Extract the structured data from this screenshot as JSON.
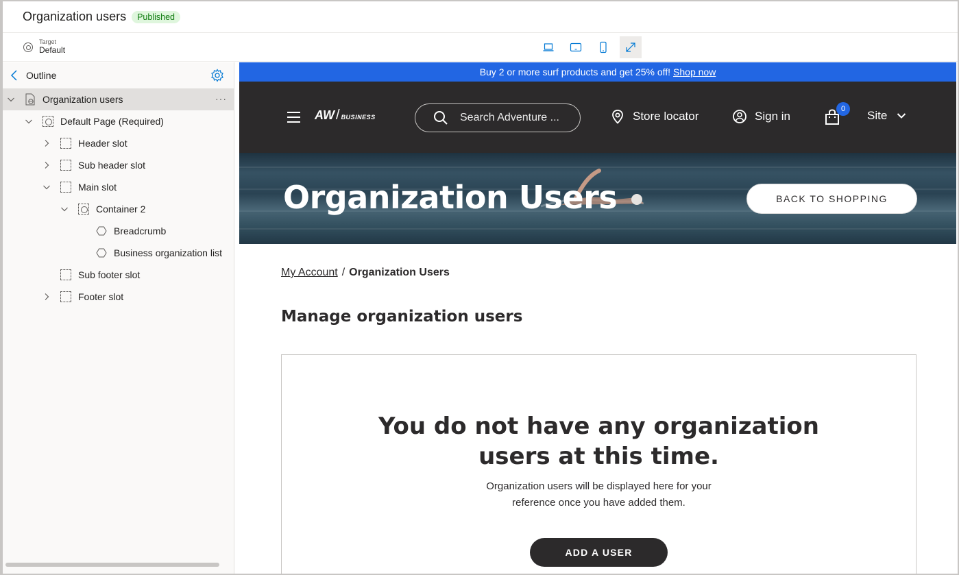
{
  "titlebar": {
    "title": "Organization users",
    "status": "Published"
  },
  "target": {
    "label": "Target",
    "value": "Default"
  },
  "devices": [
    "laptop-icon",
    "tablet-landscape-icon",
    "mobile-icon",
    "expand-icon"
  ],
  "outline": {
    "title": "Outline",
    "items": [
      {
        "label": "Organization users",
        "type": "page",
        "more": "···"
      },
      {
        "label": "Default Page (Required)",
        "type": "container"
      },
      {
        "label": "Header slot",
        "type": "slot"
      },
      {
        "label": "Sub header slot",
        "type": "slot"
      },
      {
        "label": "Main slot",
        "type": "slot"
      },
      {
        "label": "Container 2",
        "type": "container"
      },
      {
        "label": "Breadcrumb",
        "type": "module"
      },
      {
        "label": "Business organization list",
        "type": "module"
      },
      {
        "label": "Sub footer slot",
        "type": "slot"
      },
      {
        "label": "Footer slot",
        "type": "slot"
      }
    ]
  },
  "promo": {
    "text": "Buy 2 or more surf products and get 25% off!",
    "link": "Shop now"
  },
  "site_header": {
    "logo_main": "AW",
    "logo_slash": "/",
    "logo_sub": "BUSINESS",
    "search_placeholder": "Search Adventure ...",
    "store_locator": "Store locator",
    "sign_in": "Sign in",
    "cart_count": "0",
    "site": "Site"
  },
  "hero": {
    "title": "Organization Users",
    "button": "BACK TO SHOPPING"
  },
  "breadcrumb": {
    "link": "My Account",
    "sep": "/",
    "current": "Organization Users"
  },
  "heading": "Manage organization users",
  "empty": {
    "title_line1": "You do not have any organization",
    "title_line2": "users at this time.",
    "desc_line1": "Organization users will be displayed here for your",
    "desc_line2": "reference once you have added them.",
    "button": "ADD A USER"
  },
  "colors": {
    "accent": "#2266e3",
    "header_bg": "#2c2a2b",
    "published_text": "#107c10",
    "published_bg": "#dff6dd"
  }
}
